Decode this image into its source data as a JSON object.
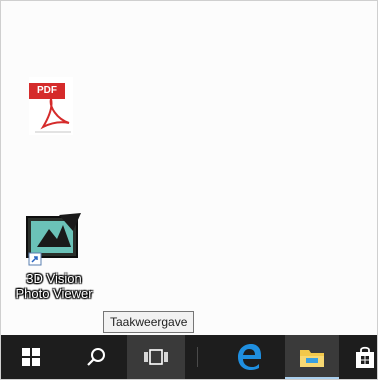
{
  "desktop": {
    "icons": [
      {
        "label": "",
        "badge": "PDF",
        "icon": "pdf-document-icon"
      },
      {
        "label": "3D Vision Photo Viewer",
        "line1": "3D Vision",
        "line2": "Photo Viewer",
        "icon": "3d-vision-photo-viewer-icon"
      }
    ]
  },
  "tooltip": {
    "text": "Taakweergave"
  },
  "taskbar": {
    "items": [
      {
        "icon": "windows-start-icon"
      },
      {
        "icon": "search-icon"
      },
      {
        "icon": "task-view-icon"
      },
      {
        "icon": "edge-browser-icon"
      },
      {
        "icon": "file-explorer-icon"
      },
      {
        "icon": "store-icon"
      }
    ]
  },
  "colors": {
    "taskbar": "#1d1d1d",
    "pdf_red": "#d52b2b",
    "edge_blue": "#1f8fe0",
    "explorer_yellow": "#f2c84b",
    "tooltip_bg": "#f2f2f2"
  }
}
